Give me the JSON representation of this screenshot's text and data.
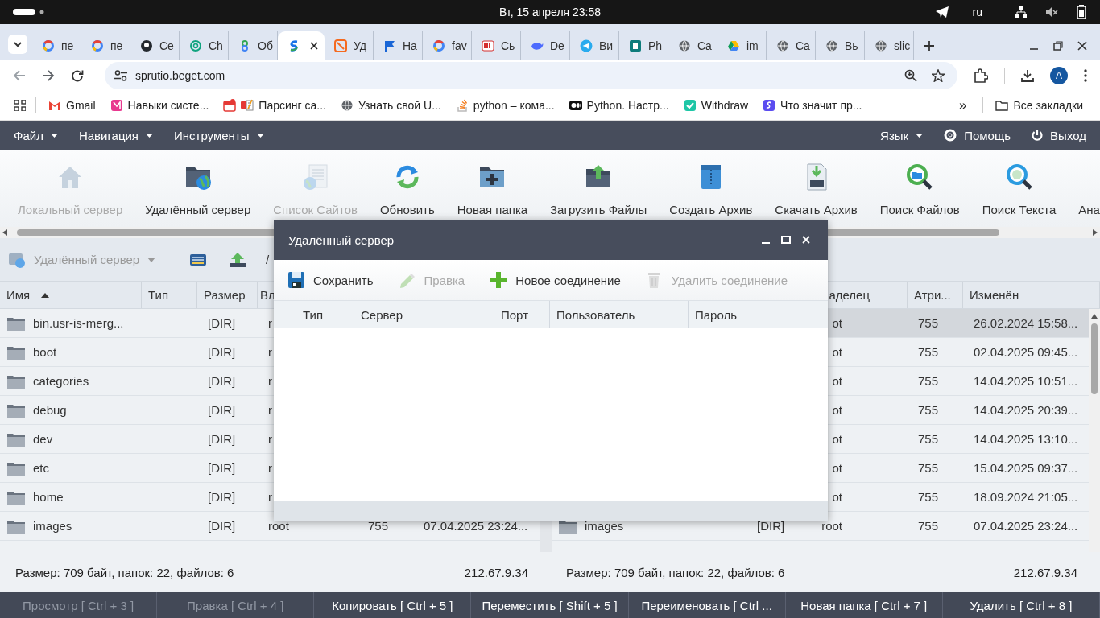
{
  "system_bar": {
    "clock": "Вт, 15 апреля  23:58",
    "language": "ru"
  },
  "browser": {
    "tabs": [
      {
        "title": "пе",
        "selected": false
      },
      {
        "title": "пе",
        "selected": false
      },
      {
        "title": "Се",
        "selected": false
      },
      {
        "title": "Ch",
        "selected": false
      },
      {
        "title": "Об",
        "selected": false
      },
      {
        "selected": true
      },
      {
        "title": "Уд",
        "selected": false
      },
      {
        "title": "На",
        "selected": false
      },
      {
        "title": "fav",
        "selected": false
      },
      {
        "title": "Сь",
        "selected": false
      },
      {
        "title": "De",
        "selected": false
      },
      {
        "title": "Ви",
        "selected": false
      },
      {
        "title": "Ph",
        "selected": false
      },
      {
        "title": "Ca",
        "selected": false
      },
      {
        "title": "im",
        "selected": false
      },
      {
        "title": "Ca",
        "selected": false
      },
      {
        "title": "Вь",
        "selected": false
      },
      {
        "title": "slic",
        "selected": false
      }
    ],
    "url": "sprutio.beget.com",
    "profile": "A",
    "bookmarks": [
      {
        "label": "Gmail"
      },
      {
        "label": "Навыки систе..."
      },
      {
        "label": "Парсинг са..."
      },
      {
        "label": "Узнать свой U..."
      },
      {
        "label": "python – кома..."
      },
      {
        "label": "Python. Настр..."
      },
      {
        "label": "Withdraw"
      },
      {
        "label": "Что значит пр..."
      }
    ],
    "more_bookmarks": "»",
    "all_bookmarks": "Все закладки"
  },
  "app": {
    "menu": [
      {
        "label": "Файл"
      },
      {
        "label": "Навигация"
      },
      {
        "label": "Инструменты"
      }
    ],
    "menu_right": [
      {
        "label": "Язык",
        "kind": "dropdown"
      },
      {
        "label": "Помощь",
        "kind": "help"
      },
      {
        "label": "Выход",
        "kind": "exit"
      }
    ],
    "toolbar": [
      {
        "label": "Локальный сервер",
        "disabled": true
      },
      {
        "label": "Удалённый сервер",
        "disabled": false
      },
      {
        "label": "Список Сайтов",
        "disabled": true
      },
      {
        "label": "Обновить",
        "disabled": false
      },
      {
        "label": "Новая папка",
        "disabled": false
      },
      {
        "label": "Загрузить Файлы",
        "disabled": false
      },
      {
        "label": "Создать Архив",
        "disabled": false
      },
      {
        "label": "Скачать Архив",
        "disabled": false
      },
      {
        "label": "Поиск Файлов",
        "disabled": false
      },
      {
        "label": "Поиск Текста",
        "disabled": false
      },
      {
        "label": "Ана",
        "disabled": false
      }
    ],
    "left_panel": {
      "server": "Удалённый сервер",
      "path": "/",
      "columns": [
        {
          "label": "Имя",
          "sorted": true
        },
        {
          "label": "Тип"
        },
        {
          "label": "Размер"
        },
        {
          "label": "Вл"
        }
      ],
      "rows": [
        {
          "name": "bin.usr-is-merg...",
          "size": "[DIR]",
          "owner": "r",
          "selected": false
        },
        {
          "name": "boot",
          "size": "[DIR]",
          "owner": "r",
          "selected": false
        },
        {
          "name": "categories",
          "size": "[DIR]",
          "owner": "r",
          "selected": false
        },
        {
          "name": "debug",
          "size": "[DIR]",
          "owner": "r",
          "selected": false
        },
        {
          "name": "dev",
          "size": "[DIR]",
          "owner": "r",
          "selected": false
        },
        {
          "name": "etc",
          "size": "[DIR]",
          "owner": "r",
          "selected": false
        },
        {
          "name": "home",
          "size": "[DIR]",
          "owner": "r",
          "selected": false
        },
        {
          "name": "images",
          "size": "[DIR]",
          "owner": "root",
          "attributes": "755",
          "modified": "07.04.2025 23:24...",
          "selected": false
        }
      ]
    },
    "right_panel": {
      "columns": [
        {
          "label": "аделец"
        },
        {
          "label": "Атри..."
        },
        {
          "label": "Изменён"
        }
      ],
      "rows": [
        {
          "owner": "ot",
          "attributes": "755",
          "modified": "26.02.2024 15:58...",
          "selected": true
        },
        {
          "owner": "ot",
          "attributes": "755",
          "modified": "02.04.2025 09:45...",
          "selected": false
        },
        {
          "owner": "ot",
          "attributes": "755",
          "modified": "14.04.2025 10:51...",
          "selected": false
        },
        {
          "owner": "ot",
          "attributes": "755",
          "modified": "14.04.2025 20:39...",
          "selected": false
        },
        {
          "owner": "ot",
          "attributes": "755",
          "modified": "14.04.2025 13:10...",
          "selected": false
        },
        {
          "owner": "ot",
          "attributes": "755",
          "modified": "15.04.2025 09:37...",
          "selected": false
        },
        {
          "owner": "ot",
          "attributes": "755",
          "modified": "18.09.2024 21:05...",
          "selected": false
        },
        {
          "name": "images",
          "size": "[DIR]",
          "owner": "root",
          "attributes": "755",
          "modified": "07.04.2025 23:24...",
          "selected": false
        }
      ]
    },
    "status": [
      {
        "summary": "Размер: 709 байт, папок: 22, файлов: 6",
        "ip": "212.67.9.34"
      },
      {
        "summary": "Размер: 709 байт, папок: 22, файлов: 6",
        "ip": "212.67.9.34"
      }
    ],
    "function_keys": [
      {
        "label": "Просмотр [ Ctrl + 3 ]",
        "disabled": true
      },
      {
        "label": "Правка [ Ctrl + 4 ]",
        "disabled": true
      },
      {
        "label": "Копировать [ Ctrl + 5 ]",
        "disabled": false
      },
      {
        "label": "Переместить [ Shift + 5 ]",
        "disabled": false
      },
      {
        "label": "Переименовать [ Ctrl ...",
        "disabled": false
      },
      {
        "label": "Новая папка [ Ctrl + 7 ]",
        "disabled": false
      },
      {
        "label": "Удалить [ Ctrl + 8 ]",
        "disabled": false
      }
    ],
    "dialog": {
      "title": "Удалённый сервер",
      "toolbar": [
        {
          "label": "Сохранить",
          "disabled": false
        },
        {
          "label": "Правка",
          "disabled": true
        },
        {
          "label": "Новое соединение",
          "disabled": false
        },
        {
          "label": "Удалить соединение",
          "disabled": true
        }
      ],
      "columns": [
        "Тип",
        "Сервер",
        "Порт",
        "Пользователь",
        "Пароль"
      ]
    }
  }
}
